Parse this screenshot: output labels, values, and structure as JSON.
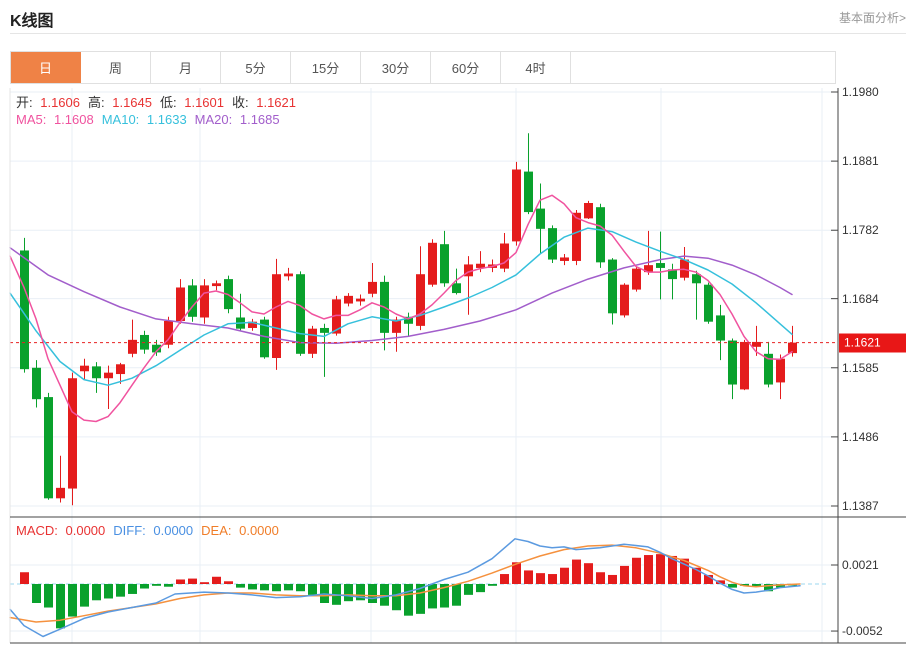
{
  "header": {
    "title": "K线图",
    "link": "基本面分析>"
  },
  "tabs": {
    "items": [
      "日",
      "周",
      "月",
      "5分",
      "15分",
      "30分",
      "60分",
      "4时"
    ],
    "selected": "日",
    "selected_bg": "#ef8246"
  },
  "legend_ohlc": {
    "label_color": "#333333",
    "value_color": "#e83333",
    "items": [
      {
        "label": "开:",
        "value": "1.1606"
      },
      {
        "label": "高:",
        "value": "1.1645"
      },
      {
        "label": "低:",
        "value": "1.1601"
      },
      {
        "label": "收:",
        "value": "1.1621"
      }
    ]
  },
  "legend_ma": {
    "items": [
      {
        "label": "MA5:",
        "value": "1.1608",
        "color": "#f0539f"
      },
      {
        "label": "MA10:",
        "value": "1.1633",
        "color": "#36c0dc"
      },
      {
        "label": "MA20:",
        "value": "1.1685",
        "color": "#a25ecb"
      }
    ]
  },
  "legend_macd": {
    "items": [
      {
        "label": "MACD:",
        "value": "0.0000",
        "color": "#e83333"
      },
      {
        "label": "DIFF:",
        "value": "0.0000",
        "color": "#4a90e2"
      },
      {
        "label": "DEA:",
        "value": "0.0000",
        "color": "#f07d28"
      }
    ]
  },
  "price_badge": {
    "value": "1.1621",
    "bg": "#e81717",
    "price": 1.1621
  },
  "chart_data": {
    "type": "candlestick+macd",
    "title": "K线图",
    "colors": {
      "up": "#e41c1c",
      "down": "#09a12c",
      "ma5": "#f0539f",
      "ma10": "#36c0dc",
      "ma20": "#a25ecb",
      "diff": "#5b9ae0",
      "dea": "#f5913e",
      "grid": "#e9eff6",
      "dotted_price_line": "#e82222",
      "macd_zero_dash": "#9bd7ef",
      "border_dark": "#444444",
      "border_light": "#e5e5e5"
    },
    "main_axis": {
      "ticks": [
        1.198,
        1.1881,
        1.1782,
        1.1684,
        1.1585,
        1.1486,
        1.1387
      ],
      "range": [
        1.1387,
        1.198
      ]
    },
    "macd_axis": {
      "ticks": [
        0.0021,
        -0.0052
      ],
      "range": [
        -0.0052,
        0.0021
      ]
    },
    "current_price": 1.1621,
    "candles_ohlc": [
      [
        1.1753,
        1.1771,
        1.1578,
        1.1583
      ],
      [
        1.1585,
        1.1596,
        1.1528,
        1.154
      ],
      [
        1.1543,
        1.1549,
        1.1396,
        1.1398
      ],
      [
        1.1398,
        1.1459,
        1.1392,
        1.1413
      ],
      [
        1.1412,
        1.1578,
        1.1388,
        1.157
      ],
      [
        1.158,
        1.1598,
        1.1568,
        1.1588
      ],
      [
        1.1587,
        1.1593,
        1.1549,
        1.157
      ],
      [
        1.157,
        1.1588,
        1.1526,
        1.1578
      ],
      [
        1.1576,
        1.1592,
        1.1562,
        1.159
      ],
      [
        1.1605,
        1.1654,
        1.16,
        1.1625
      ],
      [
        1.1632,
        1.1638,
        1.1605,
        1.1611
      ],
      [
        1.1618,
        1.1625,
        1.1602,
        1.1607
      ],
      [
        1.1618,
        1.1658,
        1.1613,
        1.1652
      ],
      [
        1.1652,
        1.1712,
        1.1648,
        1.17
      ],
      [
        1.1703,
        1.1712,
        1.1651,
        1.1658
      ],
      [
        1.1657,
        1.1712,
        1.1648,
        1.1703
      ],
      [
        1.1702,
        1.171,
        1.1696,
        1.1706
      ],
      [
        1.1712,
        1.1717,
        1.1663,
        1.1669
      ],
      [
        1.1657,
        1.1691,
        1.1638,
        1.1641
      ],
      [
        1.1642,
        1.1655,
        1.1638,
        1.1651
      ],
      [
        1.1654,
        1.1658,
        1.1598,
        1.16
      ],
      [
        1.1599,
        1.1741,
        1.1582,
        1.1719
      ],
      [
        1.1716,
        1.1728,
        1.171,
        1.172
      ],
      [
        1.1719,
        1.1723,
        1.1602,
        1.1605
      ],
      [
        1.1605,
        1.1645,
        1.1599,
        1.1641
      ],
      [
        1.1642,
        1.1648,
        1.1572,
        1.1635
      ],
      [
        1.1634,
        1.1688,
        1.1631,
        1.1683
      ],
      [
        1.1677,
        1.1692,
        1.1673,
        1.1688
      ],
      [
        1.168,
        1.169,
        1.1674,
        1.1684
      ],
      [
        1.1691,
        1.1735,
        1.1686,
        1.1708
      ],
      [
        1.1708,
        1.1717,
        1.161,
        1.1635
      ],
      [
        1.1635,
        1.1658,
        1.1608,
        1.1654
      ],
      [
        1.1658,
        1.1664,
        1.1629,
        1.1648
      ],
      [
        1.1645,
        1.1759,
        1.1639,
        1.1719
      ],
      [
        1.1704,
        1.1769,
        1.1701,
        1.1764
      ],
      [
        1.1762,
        1.1781,
        1.1701,
        1.1706
      ],
      [
        1.1706,
        1.1727,
        1.169,
        1.1692
      ],
      [
        1.1716,
        1.1745,
        1.1661,
        1.1733
      ],
      [
        1.1728,
        1.1752,
        1.1722,
        1.1734
      ],
      [
        1.1728,
        1.174,
        1.1722,
        1.1733
      ],
      [
        1.1727,
        1.1778,
        1.1722,
        1.1763
      ],
      [
        1.1766,
        1.188,
        1.176,
        1.1869
      ],
      [
        1.1866,
        1.1921,
        1.1805,
        1.1808
      ],
      [
        1.1813,
        1.1849,
        1.1749,
        1.1784
      ],
      [
        1.1785,
        1.1789,
        1.1735,
        1.174
      ],
      [
        1.1738,
        1.1748,
        1.1732,
        1.1743
      ],
      [
        1.1738,
        1.1811,
        1.1732,
        1.1807
      ],
      [
        1.1799,
        1.1824,
        1.1798,
        1.1821
      ],
      [
        1.1815,
        1.182,
        1.1728,
        1.1736
      ],
      [
        1.174,
        1.1742,
        1.1647,
        1.1663
      ],
      [
        1.166,
        1.1706,
        1.1657,
        1.1704
      ],
      [
        1.1697,
        1.173,
        1.1694,
        1.1727
      ],
      [
        1.1722,
        1.1781,
        1.1718,
        1.1732
      ],
      [
        1.1735,
        1.178,
        1.1683,
        1.1728
      ],
      [
        1.1726,
        1.1734,
        1.1683,
        1.1712
      ],
      [
        1.1714,
        1.1758,
        1.171,
        1.174
      ],
      [
        1.1719,
        1.1724,
        1.1654,
        1.1706
      ],
      [
        1.1704,
        1.1707,
        1.1648,
        1.1651
      ],
      [
        1.166,
        1.1675,
        1.1596,
        1.1624
      ],
      [
        1.1624,
        1.1627,
        1.154,
        1.1561
      ],
      [
        1.1554,
        1.1625,
        1.1553,
        1.1622
      ],
      [
        1.1615,
        1.1645,
        1.1602,
        1.1622
      ],
      [
        1.1605,
        1.1622,
        1.1557,
        1.1561
      ],
      [
        1.1564,
        1.1604,
        1.154,
        1.1598
      ],
      [
        1.1606,
        1.1645,
        1.1601,
        1.1621
      ]
    ],
    "macd_histogram": [
      0.0013,
      -0.0021,
      -0.0026,
      -0.0049,
      -0.0036,
      -0.0025,
      -0.0018,
      -0.0016,
      -0.0014,
      -0.0011,
      -0.0005,
      -0.0002,
      -0.0003,
      0.0005,
      0.0006,
      0.0002,
      0.0008,
      0.0003,
      -0.0004,
      -0.0006,
      -0.0007,
      -0.0008,
      -0.0007,
      -0.0008,
      -0.0012,
      -0.0021,
      -0.0023,
      -0.0019,
      -0.0018,
      -0.0021,
      -0.0024,
      -0.0029,
      -0.0035,
      -0.0033,
      -0.0027,
      -0.0026,
      -0.0024,
      -0.0012,
      -0.0009,
      -0.0002,
      0.0011,
      0.0024,
      0.0015,
      0.0012,
      0.0011,
      0.0018,
      0.0027,
      0.0023,
      0.0013,
      0.001,
      0.002,
      0.0029,
      0.0032,
      0.0033,
      0.0031,
      0.0028,
      0.0018,
      0.001,
      0.0004,
      -0.0004,
      -0.0002,
      -0.0003,
      -0.0008,
      -0.0004,
      -0.0001
    ],
    "ma5_points": [
      [
        10,
        1.1745
      ],
      [
        24,
        1.17
      ],
      [
        36,
        1.1655
      ],
      [
        48,
        1.1598
      ],
      [
        60,
        1.156
      ],
      [
        72,
        1.1522
      ],
      [
        84,
        1.151
      ],
      [
        96,
        1.1508
      ],
      [
        108,
        1.1515
      ],
      [
        120,
        1.1535
      ],
      [
        132,
        1.156
      ],
      [
        144,
        1.1585
      ],
      [
        156,
        1.1608
      ],
      [
        168,
        1.1625
      ],
      [
        180,
        1.165
      ],
      [
        192,
        1.1672
      ],
      [
        204,
        1.1692
      ],
      [
        216,
        1.1695
      ],
      [
        228,
        1.169
      ],
      [
        240,
        1.1678
      ],
      [
        252,
        1.1665
      ],
      [
        264,
        1.1662
      ],
      [
        276,
        1.1672
      ],
      [
        288,
        1.168
      ],
      [
        300,
        1.1674
      ],
      [
        312,
        1.1662
      ],
      [
        324,
        1.1655
      ],
      [
        336,
        1.166
      ],
      [
        348,
        1.166
      ],
      [
        360,
        1.1668
      ],
      [
        372,
        1.1678
      ],
      [
        384,
        1.1672
      ],
      [
        396,
        1.1662
      ],
      [
        408,
        1.1655
      ],
      [
        420,
        1.1662
      ],
      [
        432,
        1.1675
      ],
      [
        444,
        1.1692
      ],
      [
        456,
        1.171
      ],
      [
        468,
        1.1722
      ],
      [
        480,
        1.1727
      ],
      [
        492,
        1.173
      ],
      [
        504,
        1.1735
      ],
      [
        516,
        1.175
      ],
      [
        528,
        1.179
      ],
      [
        540,
        1.1825
      ],
      [
        552,
        1.1832
      ],
      [
        564,
        1.182
      ],
      [
        576,
        1.18
      ],
      [
        588,
        1.1793
      ],
      [
        600,
        1.1788
      ],
      [
        612,
        1.1775
      ],
      [
        624,
        1.1752
      ],
      [
        636,
        1.173
      ],
      [
        648,
        1.1722
      ],
      [
        660,
        1.1722
      ],
      [
        672,
        1.1725
      ],
      [
        684,
        1.1726
      ],
      [
        696,
        1.1722
      ],
      [
        708,
        1.171
      ],
      [
        720,
        1.169
      ],
      [
        732,
        1.1662
      ],
      [
        744,
        1.163
      ],
      [
        756,
        1.1608
      ],
      [
        768,
        1.1598
      ],
      [
        780,
        1.1597
      ],
      [
        792,
        1.1608
      ]
    ],
    "ma10_points": [
      [
        10,
        1.1692
      ],
      [
        36,
        1.1638
      ],
      [
        60,
        1.1594
      ],
      [
        84,
        1.1568
      ],
      [
        108,
        1.156
      ],
      [
        132,
        1.157
      ],
      [
        156,
        1.1588
      ],
      [
        180,
        1.161
      ],
      [
        204,
        1.1632
      ],
      [
        228,
        1.1648
      ],
      [
        252,
        1.165
      ],
      [
        276,
        1.1642
      ],
      [
        300,
        1.1634
      ],
      [
        324,
        1.163
      ],
      [
        348,
        1.1648
      ],
      [
        372,
        1.1658
      ],
      [
        396,
        1.1652
      ],
      [
        420,
        1.166
      ],
      [
        444,
        1.1672
      ],
      [
        468,
        1.1685
      ],
      [
        492,
        1.17
      ],
      [
        516,
        1.1718
      ],
      [
        540,
        1.1748
      ],
      [
        564,
        1.1772
      ],
      [
        588,
        1.1785
      ],
      [
        612,
        1.178
      ],
      [
        636,
        1.1765
      ],
      [
        660,
        1.1752
      ],
      [
        684,
        1.174
      ],
      [
        708,
        1.1725
      ],
      [
        732,
        1.1705
      ],
      [
        756,
        1.1678
      ],
      [
        780,
        1.1648
      ],
      [
        792,
        1.1633
      ]
    ],
    "ma20_points": [
      [
        10,
        1.1757
      ],
      [
        48,
        1.1718
      ],
      [
        84,
        1.1694
      ],
      [
        120,
        1.1672
      ],
      [
        156,
        1.1655
      ],
      [
        192,
        1.1648
      ],
      [
        228,
        1.1642
      ],
      [
        264,
        1.163
      ],
      [
        300,
        1.1621
      ],
      [
        336,
        1.162
      ],
      [
        372,
        1.1624
      ],
      [
        408,
        1.163
      ],
      [
        444,
        1.164
      ],
      [
        480,
        1.1652
      ],
      [
        516,
        1.1668
      ],
      [
        552,
        1.1692
      ],
      [
        588,
        1.1712
      ],
      [
        624,
        1.1728
      ],
      [
        660,
        1.174
      ],
      [
        684,
        1.1745
      ],
      [
        708,
        1.1742
      ],
      [
        732,
        1.1732
      ],
      [
        756,
        1.1718
      ],
      [
        780,
        1.17
      ],
      [
        792,
        1.169
      ]
    ],
    "diff_points": [
      [
        10,
        -0.0028
      ],
      [
        24,
        -0.0046
      ],
      [
        43,
        -0.0058
      ],
      [
        60,
        -0.005
      ],
      [
        84,
        -0.0038
      ],
      [
        108,
        -0.0031
      ],
      [
        132,
        -0.0026
      ],
      [
        156,
        -0.0021
      ],
      [
        175,
        -0.0011
      ],
      [
        204,
        -0.0009
      ],
      [
        228,
        -0.001
      ],
      [
        252,
        -0.0012
      ],
      [
        276,
        -0.0015
      ],
      [
        300,
        -0.0014
      ],
      [
        324,
        -0.0011
      ],
      [
        348,
        -0.0013
      ],
      [
        372,
        -0.0016
      ],
      [
        396,
        -0.0012
      ],
      [
        420,
        -0.0005
      ],
      [
        444,
        0.0005
      ],
      [
        468,
        0.0013
      ],
      [
        492,
        0.0028
      ],
      [
        515,
        0.005
      ],
      [
        528,
        0.0047
      ],
      [
        540,
        0.0042
      ],
      [
        552,
        0.004
      ],
      [
        564,
        0.0041
      ],
      [
        576,
        0.0038
      ],
      [
        600,
        0.004
      ],
      [
        624,
        0.0044
      ],
      [
        648,
        0.0041
      ],
      [
        660,
        0.0035
      ],
      [
        672,
        0.0028
      ],
      [
        684,
        0.0022
      ],
      [
        696,
        0.0016
      ],
      [
        708,
        0.0009
      ],
      [
        720,
        0.0001
      ],
      [
        732,
        -0.0006
      ],
      [
        744,
        -0.001
      ],
      [
        756,
        -0.0009
      ],
      [
        768,
        -0.0007
      ],
      [
        780,
        -0.0004
      ],
      [
        800,
        -0.0002
      ]
    ],
    "dea_points": [
      [
        10,
        -0.0037
      ],
      [
        36,
        -0.0042
      ],
      [
        60,
        -0.004
      ],
      [
        84,
        -0.0035
      ],
      [
        108,
        -0.003
      ],
      [
        132,
        -0.0026
      ],
      [
        156,
        -0.0022
      ],
      [
        180,
        -0.0016
      ],
      [
        204,
        -0.0012
      ],
      [
        228,
        -0.001
      ],
      [
        252,
        -0.001
      ],
      [
        276,
        -0.0012
      ],
      [
        300,
        -0.0013
      ],
      [
        324,
        -0.0013
      ],
      [
        348,
        -0.0012
      ],
      [
        372,
        -0.0013
      ],
      [
        396,
        -0.0013
      ],
      [
        420,
        -0.001
      ],
      [
        444,
        -0.0004
      ],
      [
        468,
        0.0003
      ],
      [
        492,
        0.0012
      ],
      [
        516,
        0.0022
      ],
      [
        540,
        0.0031
      ],
      [
        564,
        0.0038
      ],
      [
        588,
        0.0042
      ],
      [
        612,
        0.0043
      ],
      [
        636,
        0.004
      ],
      [
        660,
        0.0034
      ],
      [
        684,
        0.0026
      ],
      [
        708,
        0.0015
      ],
      [
        720,
        0.0008
      ],
      [
        732,
        0.0002
      ],
      [
        744,
        -0.0002
      ],
      [
        756,
        -0.0003
      ],
      [
        768,
        -0.0002
      ],
      [
        780,
        -0.0001
      ],
      [
        800,
        0.0
      ]
    ]
  }
}
